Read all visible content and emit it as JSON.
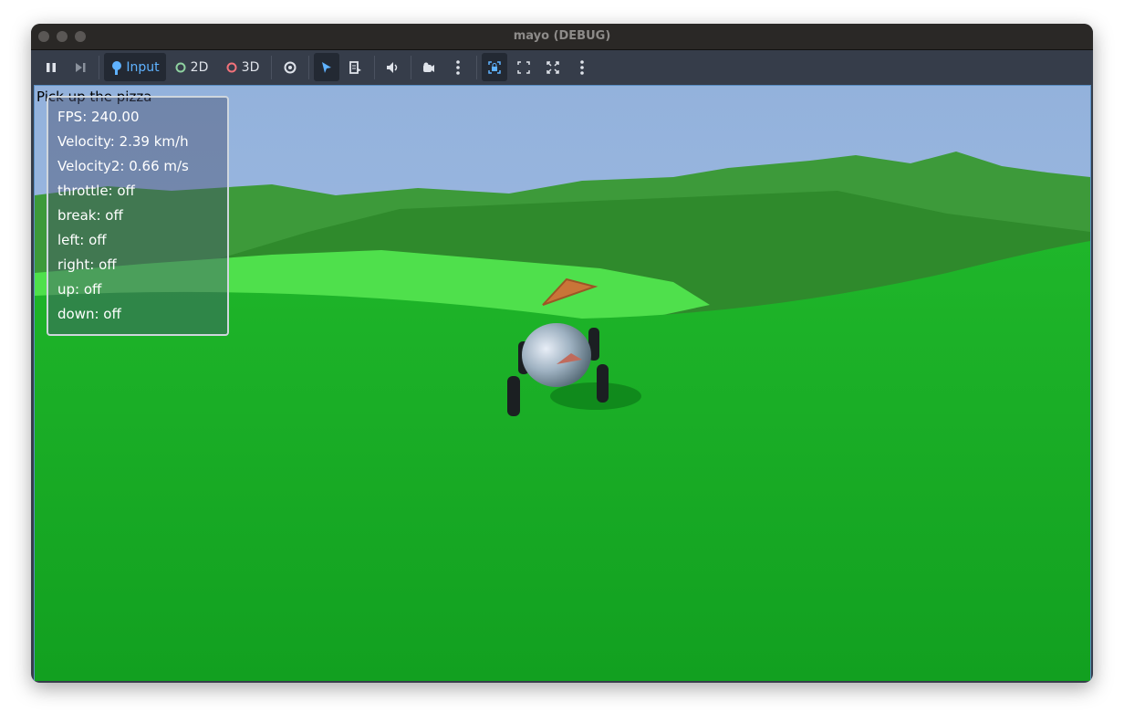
{
  "window": {
    "title": "mayo (DEBUG)"
  },
  "toolbar": {
    "input_label": "Input",
    "2d_label": "2D",
    "3d_label": "3D"
  },
  "hud": {
    "objective": "Pick up the pizza",
    "lines": [
      "FPS: 240.00",
      "Velocity: 2.39 km/h",
      "Velocity2: 0.66 m/s",
      "throttle: off",
      "break: off",
      "left: off",
      "right: off",
      "up: off",
      "down: off"
    ]
  },
  "colors": {
    "accent": "#5fb2ff",
    "toolbar_bg": "#363d4a",
    "grass": "#1fa82a"
  }
}
